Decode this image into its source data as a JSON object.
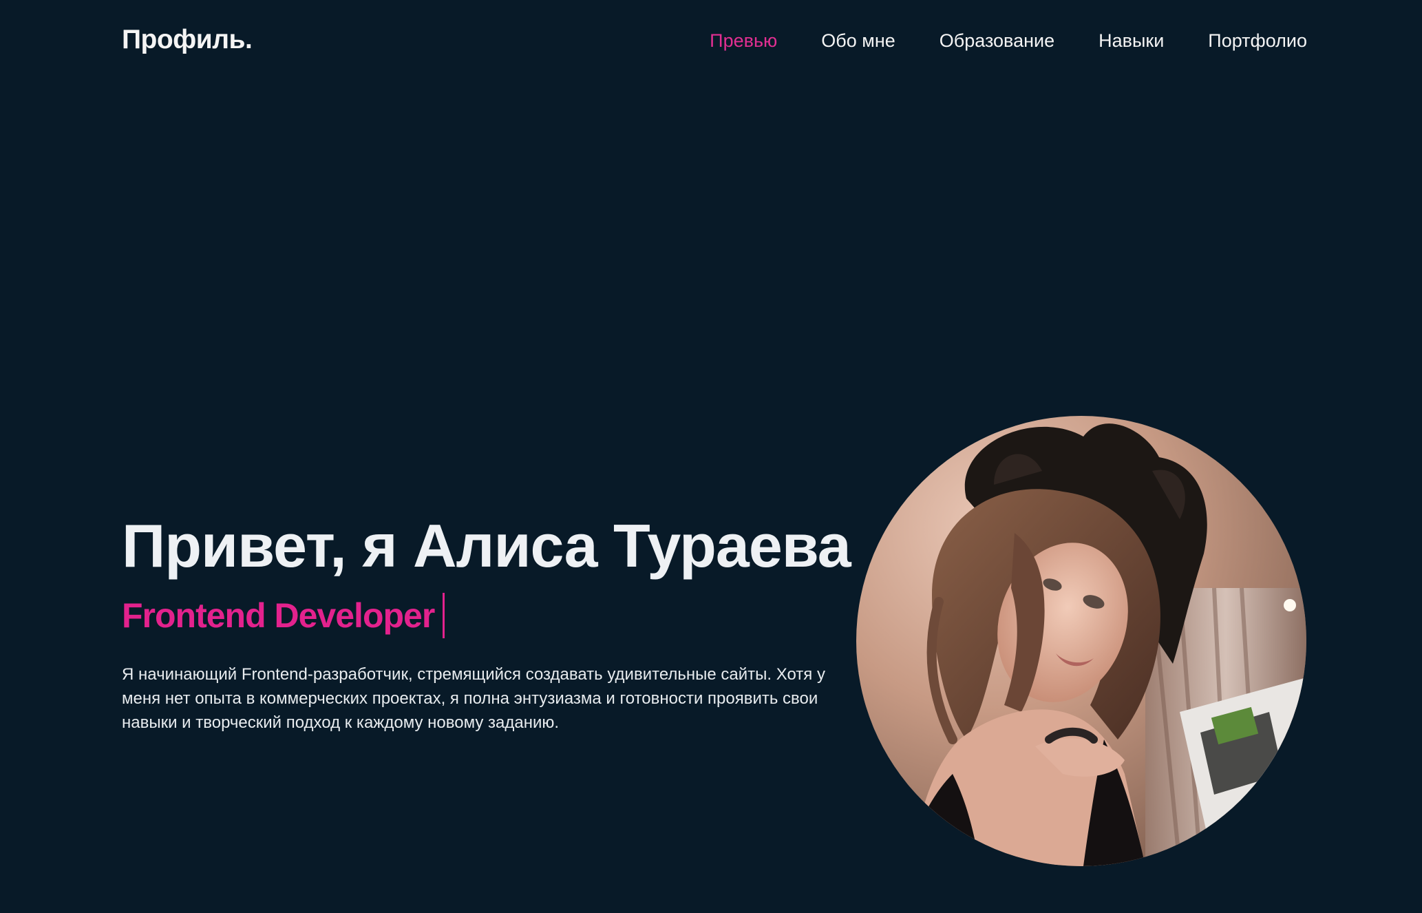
{
  "header": {
    "logo": "Профиль.",
    "nav": [
      {
        "label": "Превью",
        "active": true
      },
      {
        "label": "Обо мне",
        "active": false
      },
      {
        "label": "Образование",
        "active": false
      },
      {
        "label": "Навыки",
        "active": false
      },
      {
        "label": "Портфолио",
        "active": false
      }
    ]
  },
  "hero": {
    "title": "Привет, я Алиса Тураева",
    "role": "Frontend Developer",
    "description": "Я начинающий Frontend-разработчик, стремящийся создавать удивительные сайты. Хотя у меня нет опыта в коммерческих проектах, я полна энтузиазма и готовности проявить свои навыки и творческий подход к каждому новому заданию."
  },
  "colors": {
    "background": "#081a28",
    "accent": "#e3228d",
    "text": "#f2f2f2"
  }
}
